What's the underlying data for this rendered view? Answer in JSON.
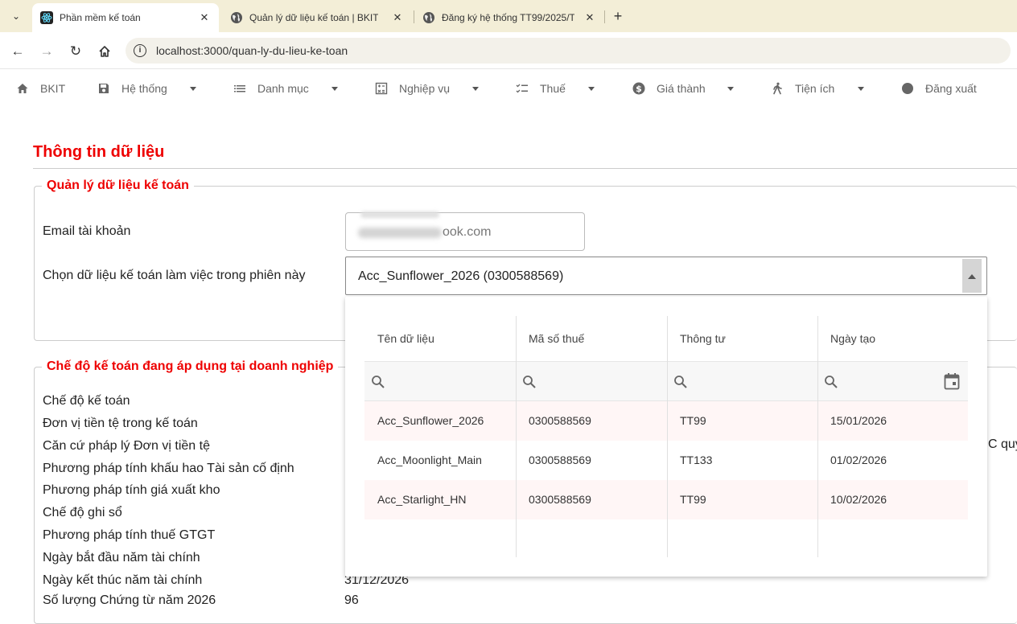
{
  "browser": {
    "tabs": [
      {
        "title": "Phần mềm kế toán",
        "active": true
      },
      {
        "title": "Quản lý dữ liệu kế toán | BKIT",
        "active": false
      },
      {
        "title": "Đăng ký hệ thống TT99/2025/T",
        "active": false
      }
    ],
    "url": "localhost:3000/quan-ly-du-lieu-ke-toan"
  },
  "menubar": {
    "items": [
      {
        "label": "BKIT",
        "icon": "home-icon",
        "has_caret": false
      },
      {
        "label": "Hệ thống",
        "icon": "save-icon",
        "has_caret": true
      },
      {
        "label": "Danh mục",
        "icon": "list-icon",
        "has_caret": true
      },
      {
        "label": "Nghiệp vụ",
        "icon": "calculator-icon",
        "has_caret": true
      },
      {
        "label": "Thuế",
        "icon": "checklist-icon",
        "has_caret": true
      },
      {
        "label": "Giá thành",
        "icon": "dollar-icon",
        "has_caret": true
      },
      {
        "label": "Tiện ích",
        "icon": "person-walking-icon",
        "has_caret": true
      },
      {
        "label": "Đăng xuất",
        "icon": "circle-icon",
        "has_caret": false
      }
    ]
  },
  "page": {
    "title": "Thông tin dữ liệu",
    "section1": {
      "legend": "Quản lý dữ liệu kế toán",
      "email_label": "Email tài khoản",
      "email_value": "ook.com",
      "select_label": "Chọn dữ liệu kế toán làm việc trong phiên này",
      "select_value": "Acc_Sunflower_2026 (0300588569)"
    },
    "section2": {
      "legend": "Chế độ kế toán đang áp dụng tại doanh nghiệp",
      "labels": [
        "Chế độ kế toán",
        "Đơn vị tiền tệ trong kế toán",
        "Căn cứ pháp lý Đơn vị tiền tệ",
        "Phương pháp tính khấu hao Tài sản cố định",
        "Phương pháp tính giá xuất kho",
        "Chế độ ghi sổ",
        "Phương pháp tính thuế GTGT",
        "Ngày bắt đầu năm tài chính",
        "Ngày kết thúc năm tài chính",
        "Số lượng Chứng từ năm 2026"
      ],
      "end_date_value": "31/12/2026",
      "voucher_count_value": "96",
      "right_cut_text": "C quy"
    }
  },
  "dropdown": {
    "columns": [
      "Tên dữ liệu",
      "Mã số thuế",
      "Thông tư",
      "Ngày tạo"
    ],
    "rows": [
      [
        "Acc_Sunflower_2026",
        "0300588569",
        "TT99",
        "15/01/2026"
      ],
      [
        "Acc_Moonlight_Main",
        "0300588569",
        "TT133",
        "01/02/2026"
      ],
      [
        "Acc_Starlight_HN",
        "0300588569",
        "TT99",
        "10/02/2026"
      ]
    ]
  },
  "colors": {
    "accent_red": "#e00000",
    "tabbar_bg": "#f3eed7",
    "row_alt": "#fff6f6"
  }
}
